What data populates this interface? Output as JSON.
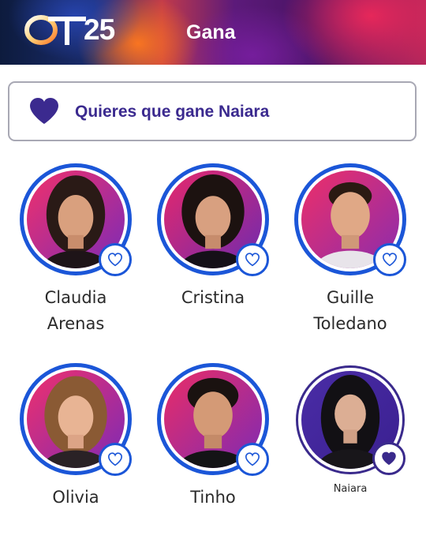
{
  "header": {
    "logo_text": "OT25",
    "title": "Gana"
  },
  "banner": {
    "text": "Quieres que gane Naiara",
    "icon": "heart-filled-icon"
  },
  "colors": {
    "accent_blue": "#1b56d8",
    "selected_purple": "#3a2a8c",
    "banner_text": "#3b2a8f"
  },
  "candidates": [
    {
      "name": "Claudia Arenas",
      "selected": false,
      "vote_icon": "heart-outline-icon"
    },
    {
      "name": "Cristina",
      "selected": false,
      "vote_icon": "heart-outline-icon"
    },
    {
      "name": "Guille Toledano",
      "selected": false,
      "vote_icon": "heart-outline-icon"
    },
    {
      "name": "Olivia",
      "selected": false,
      "vote_icon": "heart-outline-icon"
    },
    {
      "name": "Tinho",
      "selected": false,
      "vote_icon": "heart-outline-icon"
    },
    {
      "name": "Naiara",
      "selected": true,
      "vote_icon": "heart-filled-icon"
    }
  ]
}
